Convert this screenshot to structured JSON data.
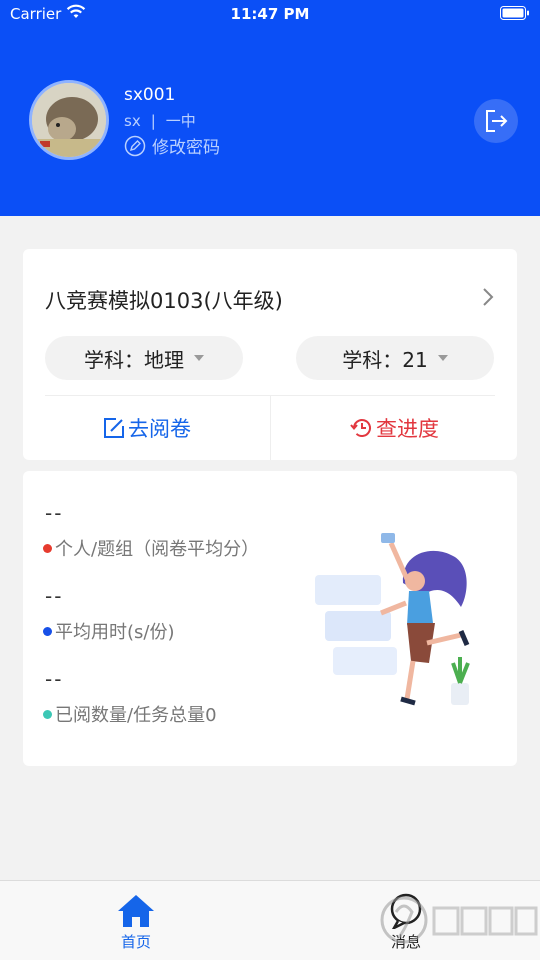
{
  "status_bar": {
    "carrier": "Carrier",
    "time": "11:47 PM"
  },
  "profile": {
    "username": "sx001",
    "subject_code": "sx",
    "separator": "|",
    "school": "一中",
    "change_password": "修改密码"
  },
  "exam": {
    "title": "八竞赛模拟0103(八年级)",
    "filter_left": "学科：地理",
    "filter_right": "学科：21",
    "go_review": "去阅卷",
    "check_progress": "查进度"
  },
  "stats": [
    {
      "value": "--",
      "label": "个人/题组（阅卷平均分）",
      "color": "#e63b2e"
    },
    {
      "value": "--",
      "label": "平均用时(s/份)",
      "color": "#1750e8"
    },
    {
      "value": "--",
      "label": "已阅数量/任务总量0",
      "color": "#3cc7b5"
    }
  ],
  "tabbar": {
    "home": "首页",
    "messages": "消息"
  },
  "colors": {
    "header": "#0b4ff6",
    "accent": "#1565e9",
    "danger": "#e2373f"
  }
}
